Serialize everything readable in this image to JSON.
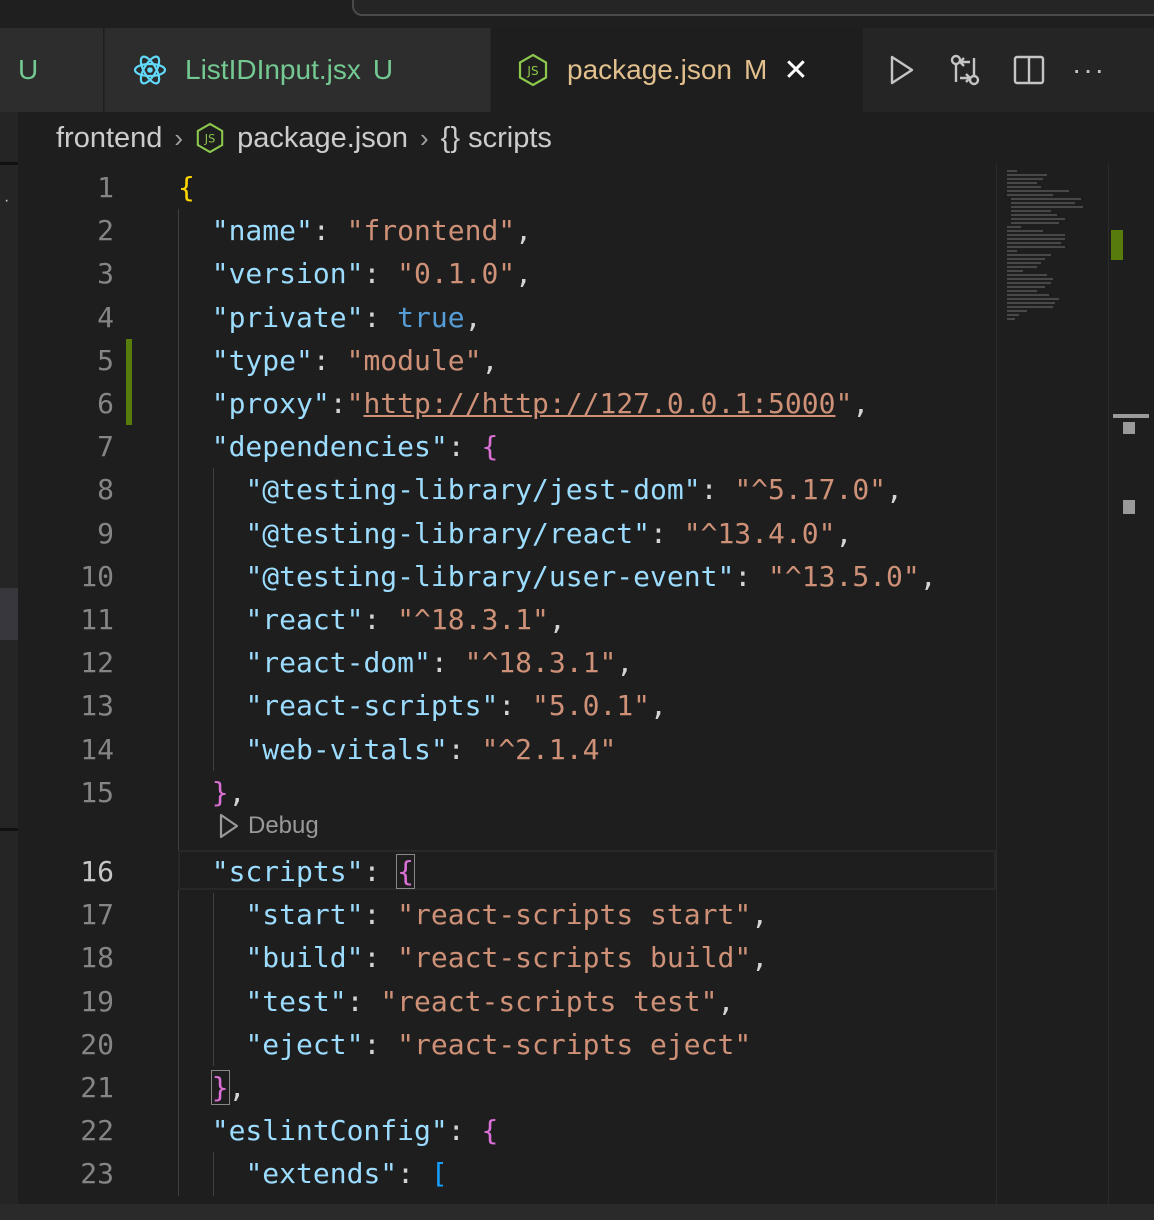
{
  "tabs": [
    {
      "label": "",
      "status": "U"
    },
    {
      "label": "ListIDInput.jsx",
      "status": "U",
      "icon": "react-icon"
    },
    {
      "label": "package.json",
      "status": "M",
      "icon": "nodejs-icon",
      "active": true
    }
  ],
  "breadcrumb": {
    "folder": "frontend",
    "file": "package.json",
    "symbol": "{} scripts"
  },
  "codelens": {
    "label": "Debug"
  },
  "lines": [
    {
      "n": "1",
      "segs": [
        {
          "t": "{",
          "c": "b1"
        }
      ]
    },
    {
      "n": "2",
      "segs": [
        {
          "t": "  "
        },
        {
          "t": "\"name\"",
          "c": "k"
        },
        {
          "t": ": "
        },
        {
          "t": "\"frontend\"",
          "c": "s"
        },
        {
          "t": ","
        }
      ]
    },
    {
      "n": "3",
      "segs": [
        {
          "t": "  "
        },
        {
          "t": "\"version\"",
          "c": "k"
        },
        {
          "t": ": "
        },
        {
          "t": "\"0.1.0\"",
          "c": "s"
        },
        {
          "t": ","
        }
      ]
    },
    {
      "n": "4",
      "segs": [
        {
          "t": "  "
        },
        {
          "t": "\"private\"",
          "c": "k"
        },
        {
          "t": ": "
        },
        {
          "t": "true",
          "c": "kw"
        },
        {
          "t": ","
        }
      ]
    },
    {
      "n": "5",
      "segs": [
        {
          "t": "  "
        },
        {
          "t": "\"type\"",
          "c": "k"
        },
        {
          "t": ": "
        },
        {
          "t": "\"module\"",
          "c": "s"
        },
        {
          "t": ","
        }
      ]
    },
    {
      "n": "6",
      "segs": [
        {
          "t": "  "
        },
        {
          "t": "\"proxy\"",
          "c": "k"
        },
        {
          "t": ":"
        },
        {
          "t": "\"",
          "c": "s"
        },
        {
          "t": "http://http://127.0.0.1:5000",
          "c": "s u"
        },
        {
          "t": "\"",
          "c": "s"
        },
        {
          "t": ","
        }
      ]
    },
    {
      "n": "7",
      "segs": [
        {
          "t": "  "
        },
        {
          "t": "\"dependencies\"",
          "c": "k"
        },
        {
          "t": ": "
        },
        {
          "t": "{",
          "c": "b2"
        }
      ]
    },
    {
      "n": "8",
      "segs": [
        {
          "t": "    "
        },
        {
          "t": "\"@testing-library/jest-dom\"",
          "c": "k"
        },
        {
          "t": ": "
        },
        {
          "t": "\"^5.17.0\"",
          "c": "s"
        },
        {
          "t": ","
        }
      ]
    },
    {
      "n": "9",
      "segs": [
        {
          "t": "    "
        },
        {
          "t": "\"@testing-library/react\"",
          "c": "k"
        },
        {
          "t": ": "
        },
        {
          "t": "\"^13.4.0\"",
          "c": "s"
        },
        {
          "t": ","
        }
      ]
    },
    {
      "n": "10",
      "segs": [
        {
          "t": "    "
        },
        {
          "t": "\"@testing-library/user-event\"",
          "c": "k"
        },
        {
          "t": ": "
        },
        {
          "t": "\"^13.5.0\"",
          "c": "s"
        },
        {
          "t": ","
        }
      ]
    },
    {
      "n": "11",
      "segs": [
        {
          "t": "    "
        },
        {
          "t": "\"react\"",
          "c": "k"
        },
        {
          "t": ": "
        },
        {
          "t": "\"^18.3.1\"",
          "c": "s"
        },
        {
          "t": ","
        }
      ]
    },
    {
      "n": "12",
      "segs": [
        {
          "t": "    "
        },
        {
          "t": "\"react-dom\"",
          "c": "k"
        },
        {
          "t": ": "
        },
        {
          "t": "\"^18.3.1\"",
          "c": "s"
        },
        {
          "t": ","
        }
      ]
    },
    {
      "n": "13",
      "segs": [
        {
          "t": "    "
        },
        {
          "t": "\"react-scripts\"",
          "c": "k"
        },
        {
          "t": ": "
        },
        {
          "t": "\"5.0.1\"",
          "c": "s"
        },
        {
          "t": ","
        }
      ]
    },
    {
      "n": "14",
      "segs": [
        {
          "t": "    "
        },
        {
          "t": "\"web-vitals\"",
          "c": "k"
        },
        {
          "t": ": "
        },
        {
          "t": "\"^2.1.4\"",
          "c": "s"
        }
      ]
    },
    {
      "n": "15",
      "segs": [
        {
          "t": "  "
        },
        {
          "t": "}",
          "c": "b2"
        },
        {
          "t": ","
        }
      ]
    },
    {
      "n": "16",
      "segs": [
        {
          "t": "  "
        },
        {
          "t": "\"scripts\"",
          "c": "k"
        },
        {
          "t": ": "
        },
        {
          "t": "{",
          "c": "b2 hl"
        }
      ],
      "current": true
    },
    {
      "n": "17",
      "segs": [
        {
          "t": "    "
        },
        {
          "t": "\"start\"",
          "c": "k"
        },
        {
          "t": ": "
        },
        {
          "t": "\"react-scripts start\"",
          "c": "s"
        },
        {
          "t": ","
        }
      ]
    },
    {
      "n": "18",
      "segs": [
        {
          "t": "    "
        },
        {
          "t": "\"build\"",
          "c": "k"
        },
        {
          "t": ": "
        },
        {
          "t": "\"react-scripts build\"",
          "c": "s"
        },
        {
          "t": ","
        }
      ]
    },
    {
      "n": "19",
      "segs": [
        {
          "t": "    "
        },
        {
          "t": "\"test\"",
          "c": "k"
        },
        {
          "t": ": "
        },
        {
          "t": "\"react-scripts test\"",
          "c": "s"
        },
        {
          "t": ","
        }
      ]
    },
    {
      "n": "20",
      "segs": [
        {
          "t": "    "
        },
        {
          "t": "\"eject\"",
          "c": "k"
        },
        {
          "t": ": "
        },
        {
          "t": "\"react-scripts eject\"",
          "c": "s"
        }
      ]
    },
    {
      "n": "21",
      "segs": [
        {
          "t": "  "
        },
        {
          "t": "}",
          "c": "b2 hl"
        },
        {
          "t": ","
        }
      ]
    },
    {
      "n": "22",
      "segs": [
        {
          "t": "  "
        },
        {
          "t": "\"eslintConfig\"",
          "c": "k"
        },
        {
          "t": ": "
        },
        {
          "t": "{",
          "c": "b2"
        }
      ]
    },
    {
      "n": "23",
      "segs": [
        {
          "t": "    "
        },
        {
          "t": "\"extends\"",
          "c": "k"
        },
        {
          "t": ": "
        },
        {
          "t": "[",
          "c": "b3"
        }
      ]
    }
  ],
  "colors": {
    "modified_gutter": "#587c0c",
    "tab_untracked": "#73c991",
    "tab_modified": "#e2c08d"
  }
}
